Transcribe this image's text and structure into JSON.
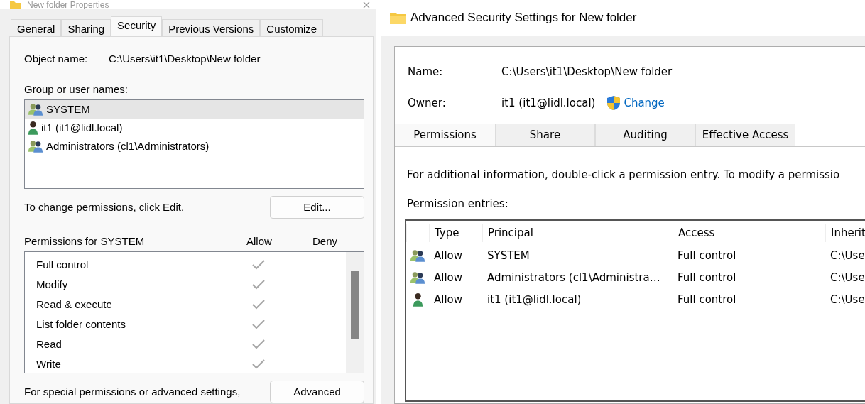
{
  "properties_window": {
    "title": "New folder Properties",
    "tabs": [
      {
        "label": "General",
        "selected": false
      },
      {
        "label": "Sharing",
        "selected": false
      },
      {
        "label": "Security",
        "selected": true
      },
      {
        "label": "Previous Versions",
        "selected": false
      },
      {
        "label": "Customize",
        "selected": false
      }
    ],
    "object_name_label": "Object name:",
    "object_name": "C:\\Users\\it1\\Desktop\\New folder",
    "group_label": "Group or user names:",
    "principals": [
      {
        "name": "SYSTEM",
        "kind": "group",
        "selected": true
      },
      {
        "name": "it1 (it1@lidl.local)",
        "kind": "user",
        "selected": false
      },
      {
        "name": "Administrators (cl1\\Administrators)",
        "kind": "group",
        "selected": false
      }
    ],
    "change_hint": "To change permissions, click Edit.",
    "edit_button": "Edit...",
    "permissions_title": "Permissions for SYSTEM",
    "allow_header": "Allow",
    "deny_header": "Deny",
    "permissions": [
      {
        "name": "Full control",
        "allow": true,
        "deny": false
      },
      {
        "name": "Modify",
        "allow": true,
        "deny": false
      },
      {
        "name": "Read & execute",
        "allow": true,
        "deny": false
      },
      {
        "name": "List folder contents",
        "allow": true,
        "deny": false
      },
      {
        "name": "Read",
        "allow": true,
        "deny": false
      },
      {
        "name": "Write",
        "allow": true,
        "deny": false
      }
    ],
    "advanced_hint": "For special permissions or advanced settings,",
    "advanced_button": "Advanced"
  },
  "advanced_window": {
    "title": "Advanced Security Settings for New folder",
    "name_label": "Name:",
    "name": "C:\\Users\\it1\\Desktop\\New folder",
    "owner_label": "Owner:",
    "owner": "it1 (it1@lidl.local)",
    "change_link": "Change",
    "tabs": [
      {
        "label": "Permissions",
        "selected": true
      },
      {
        "label": "Share",
        "selected": false
      },
      {
        "label": "Auditing",
        "selected": false
      },
      {
        "label": "Effective Access",
        "selected": false
      }
    ],
    "info": "For additional information, double-click a permission entry. To modify a permissio",
    "entries_label": "Permission entries:",
    "table": {
      "columns": [
        "Type",
        "Principal",
        "Access",
        "Inherit"
      ],
      "rows": [
        {
          "kind": "group",
          "type": "Allow",
          "principal": "SYSTEM",
          "access": "Full control",
          "column_5": "C:\\Use"
        },
        {
          "kind": "group",
          "type": "Allow",
          "principal": "Administrators (cl1\\Administra…",
          "access": "Full control",
          "column_5": "C:\\Use"
        },
        {
          "kind": "user",
          "type": "Allow",
          "principal": "it1 (it1@lidl.local)",
          "access": "Full control",
          "column_5": "C:\\Use"
        }
      ]
    }
  }
}
